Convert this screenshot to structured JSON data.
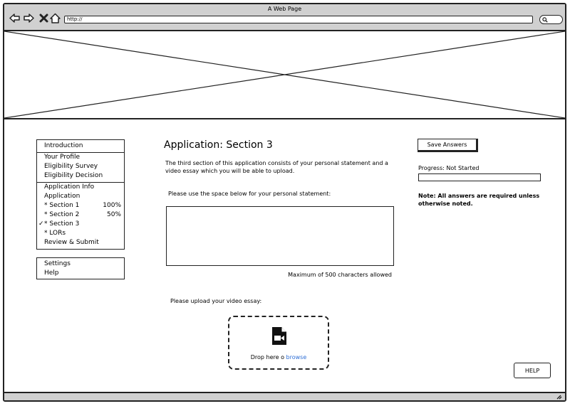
{
  "browser": {
    "window_title": "A Web Page",
    "url": "http://"
  },
  "sidebar": {
    "items": [
      {
        "label": "Introduction",
        "percent": ""
      },
      {
        "label": "Your Profile",
        "percent": ""
      },
      {
        "label": "Eligibility Survey",
        "percent": ""
      },
      {
        "label": "Eligibility Decision",
        "percent": ""
      },
      {
        "label": "Application Info",
        "percent": ""
      },
      {
        "label": "Application",
        "percent": ""
      },
      {
        "label": "* Section 1",
        "percent": "100%"
      },
      {
        "label": "* Section 2",
        "percent": "50%"
      },
      {
        "label": "* Section 3",
        "percent": "",
        "checkmark": "✓"
      },
      {
        "label": "* LORs",
        "percent": ""
      },
      {
        "label": "Review & Submit",
        "percent": ""
      }
    ],
    "secondary": [
      {
        "label": "Settings"
      },
      {
        "label": "Help"
      }
    ]
  },
  "main": {
    "title": "Application: Section 3",
    "intro": "The third section of this application consists of your personal statement and a video essay which you will be able to upload.",
    "statement_label": "Please use the space below for your personal statement:",
    "statement_value": "",
    "char_limit": "Maximum of 500 characters allowed",
    "video_label": "Please upload your video essay:",
    "drop_text": "Drop here o",
    "browse_label": "browse",
    "icons": {
      "upload": "video-file-icon"
    }
  },
  "right": {
    "save_label": "Save Answers",
    "progress_label": "Progress: Not Started",
    "progress_fraction": 0,
    "note": "Note: All answers are required unless otherwise noted."
  },
  "help_label": "HELP"
}
